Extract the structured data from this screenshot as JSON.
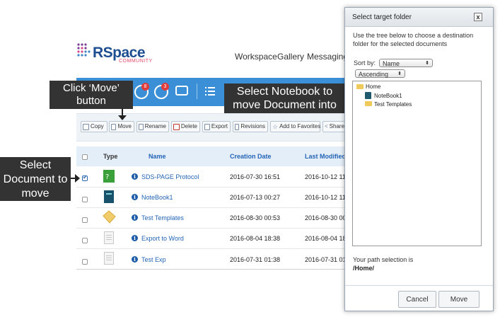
{
  "header": {
    "logo_main": "RSpace",
    "logo_sub": "COMMUNITY",
    "nav": [
      "Workspace",
      "Gallery",
      "Messaging"
    ],
    "notif_badges": [
      "8",
      "3"
    ]
  },
  "toolbar": {
    "buttons": [
      "Copy",
      "Move",
      "Rename",
      "Delete",
      "Export",
      "Revisions",
      "Add to Favorites",
      "Share"
    ]
  },
  "table": {
    "headers": [
      "Type",
      "Name",
      "Creation Date",
      "Last Modified"
    ],
    "rows": [
      {
        "name": "SDS-PAGE Protocol",
        "created": "2016-07-30 16:51",
        "modified": "2016-10-12 11:",
        "checked": true,
        "type": "structured-document"
      },
      {
        "name": "NoteBook1",
        "created": "2016-07-13 00:27",
        "modified": "2016-10-12 11:",
        "checked": false,
        "type": "notebook"
      },
      {
        "name": "Test Templates",
        "created": "2016-08-30 00:53",
        "modified": "2016-08-30 00:",
        "checked": false,
        "type": "folder"
      },
      {
        "name": "Export to Word",
        "created": "2016-08-04 18:38",
        "modified": "2016-08-04 18:",
        "checked": false,
        "type": "document"
      },
      {
        "name": "Test Exp",
        "created": "2016-07-31 01:38",
        "modified": "2016-07-31 01:",
        "checked": false,
        "type": "document"
      }
    ]
  },
  "callouts": {
    "move": "Click ‘Move’ button",
    "notebook": "Select Notebook to move Document into",
    "document": "Select Document to move"
  },
  "dialog": {
    "title": "Select target folder",
    "close": "x",
    "instructions": "Use the tree below to choose a destination folder for the selected documents",
    "sort_label": "Sort by:",
    "sort_value": "Name",
    "order_value": "Ascending",
    "tree": {
      "root": "Home",
      "children": [
        "NoteBook1",
        "Test Templates"
      ]
    },
    "path_label": "Your path selection is",
    "path_value": "/Home/",
    "cancel": "Cancel",
    "move": "Move"
  },
  "colors": {
    "brand_blue": "#3a8fd6",
    "link_blue": "#2364b6",
    "callout_bg": "#333333",
    "badge_red": "#e03b3b"
  }
}
